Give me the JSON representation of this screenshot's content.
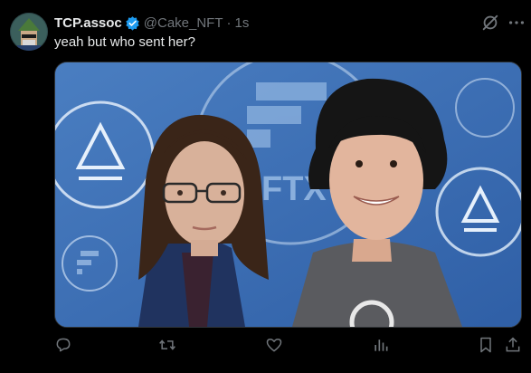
{
  "post": {
    "display_name": "TCP.assoc",
    "handle": "@Cake_NFT",
    "separator": "·",
    "time": "1s",
    "text": "yeah but who sent her?",
    "verified": true
  },
  "media": {
    "logo_text": "FTX"
  },
  "actions": [
    {
      "icon": "reply-icon"
    },
    {
      "icon": "repost-icon"
    },
    {
      "icon": "like-icon"
    },
    {
      "icon": "views-icon"
    },
    {
      "icon": "bookmark-icon"
    },
    {
      "icon": "share-icon"
    }
  ],
  "colors": {
    "background": "#000000",
    "text": "#e7e9ea",
    "muted": "#71767b",
    "verified": "#1d9bf0",
    "media_blue": "#3f6fb3"
  }
}
